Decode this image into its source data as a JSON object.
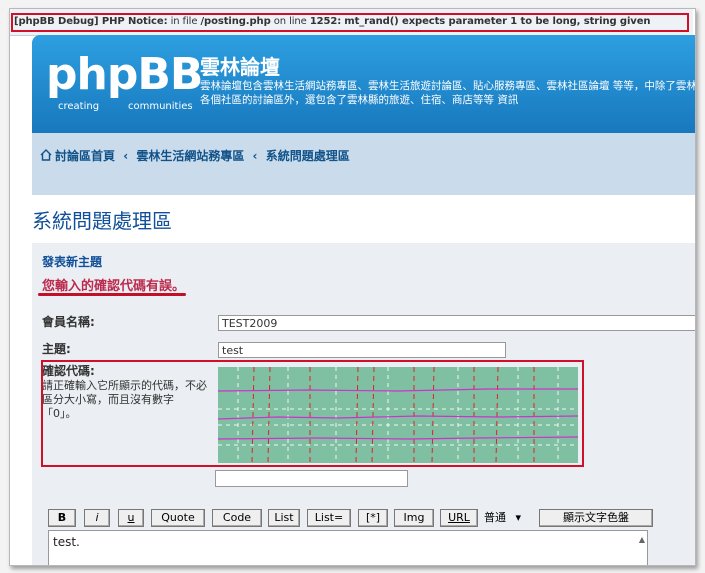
{
  "debug": {
    "prefix": "[phpBB Debug] PHP Notice:",
    "in_file": "in file",
    "file": "/posting.php",
    "on_line": "on line",
    "line": "1252:",
    "message": "mt_rand() expects parameter 1 to be long, string given"
  },
  "header": {
    "logo": "phpBB",
    "logo_sub1": "creating",
    "logo_sub2": "communities",
    "site_title": "雲林論壇",
    "site_desc": "雲林論壇包含雲林生活網站務專區、雲林生活旅遊討論區、貼心服務專區、雲林社區論壇 等等，中除了雲林縣各個社區的討論區外，還包含了雲林縣的旅遊、住宿、商店等等 資訊"
  },
  "breadcrumb": {
    "home": "討論區首頁",
    "sep": "‹",
    "item1": "雲林生活網站務專區",
    "item2": "系統問題處理區"
  },
  "page_title": "系統問題處理區",
  "form": {
    "section_title": "發表新主題",
    "error": "您輸入的確認代碼有誤。",
    "username_label": "會員名稱:",
    "username_value": "TEST2009",
    "subject_label": "主題:",
    "subject_value": "test",
    "confirm_title": "確認代碼:",
    "confirm_desc": "請正確輸入它所顯示的代碼，不必區分大小寫，而且沒有數字「0」。",
    "confirm_input": "",
    "message_text": "test."
  },
  "toolbar": {
    "bold": "B",
    "italic": "i",
    "underline": "u",
    "quote": "Quote",
    "code": "Code",
    "list": "List",
    "list_eq": "List=",
    "list_item": "[*]",
    "img": "Img",
    "url": "URL",
    "font_size": "普通",
    "font_size_arrow": "▾",
    "color_button": "顯示文字色盤"
  },
  "colors": {
    "debug_box": "#d0102a",
    "header": "#1f8dd0",
    "nav": "#cadceb",
    "link": "#105289",
    "error": "#bc2a4d",
    "captcha_bg": "#7fc0a2"
  }
}
